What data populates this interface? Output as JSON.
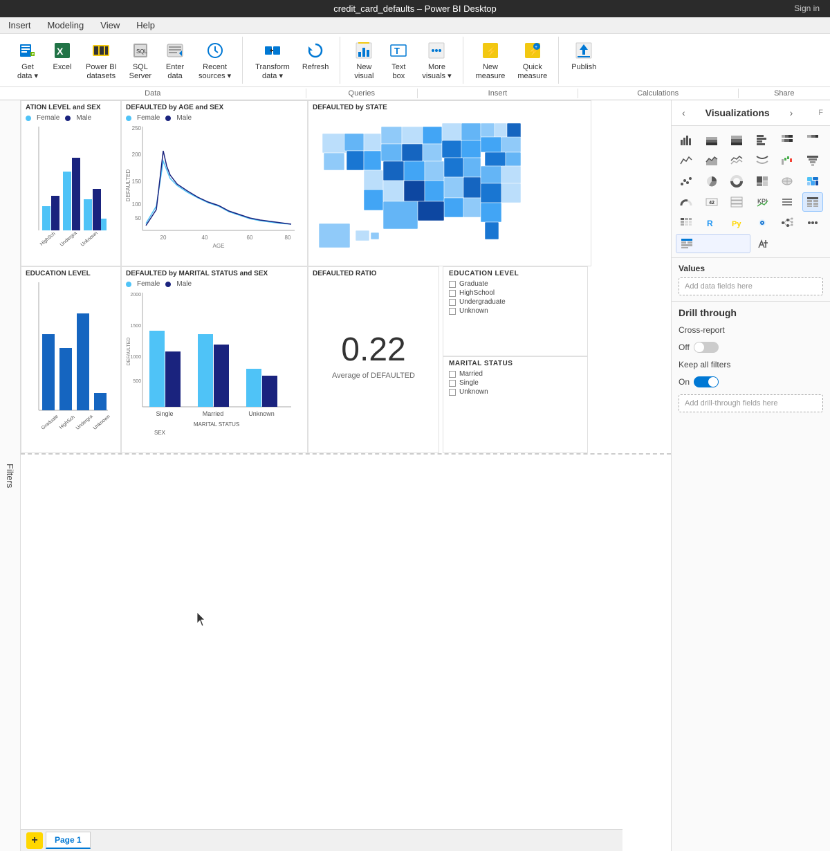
{
  "titlebar": {
    "title": "credit_card_defaults – Power BI Desktop",
    "signin": "Sign in"
  },
  "menu": {
    "items": [
      "Insert",
      "Modeling",
      "View",
      "Help"
    ]
  },
  "ribbon": {
    "groups": [
      {
        "label": "Data",
        "buttons": [
          {
            "id": "get-data",
            "icon": "🗄",
            "label": "Get\ndata ▾"
          },
          {
            "id": "excel",
            "icon": "📊",
            "label": "Excel"
          },
          {
            "id": "power-bi-datasets",
            "icon": "📁",
            "label": "Power BI\ndatasets"
          },
          {
            "id": "sql-server",
            "icon": "🔲",
            "label": "SQL\nServer"
          },
          {
            "id": "enter-data",
            "icon": "📋",
            "label": "Enter\ndata"
          },
          {
            "id": "recent-sources",
            "icon": "🕐",
            "label": "Recent\nsources ▾"
          }
        ]
      },
      {
        "label": "Queries",
        "buttons": [
          {
            "id": "transform-data",
            "icon": "⚙",
            "label": "Transform\ndata ▾"
          },
          {
            "id": "refresh",
            "icon": "🔄",
            "label": "Refresh"
          }
        ]
      },
      {
        "label": "Insert",
        "buttons": [
          {
            "id": "new-visual",
            "icon": "📈",
            "label": "New\nvisual"
          },
          {
            "id": "text-box",
            "icon": "T",
            "label": "Text\nbox"
          },
          {
            "id": "more-visuals",
            "icon": "📉",
            "label": "More\nvisuals ▾"
          }
        ]
      },
      {
        "label": "Calculations",
        "buttons": [
          {
            "id": "new-measure",
            "icon": "⚡",
            "label": "New\nmeasure"
          },
          {
            "id": "quick-measure",
            "icon": "⚡",
            "label": "Quick\nmeasure"
          }
        ]
      },
      {
        "label": "Share",
        "buttons": [
          {
            "id": "publish",
            "icon": "📤",
            "label": "Publish"
          }
        ]
      }
    ]
  },
  "canvas": {
    "charts": [
      {
        "id": "education",
        "title": "ATION LEVEL and SEX"
      },
      {
        "id": "age",
        "title": "DEFAULTED by AGE and SEX"
      },
      {
        "id": "state",
        "title": "DEFAULTED by STATE"
      },
      {
        "id": "edu-level",
        "title": "EDUCATION LEVEL"
      },
      {
        "id": "marital",
        "title": "DEFAULTED by MARITAL STATUS and SEX"
      },
      {
        "id": "ratio",
        "title": "DEFAULTED RATIO"
      },
      {
        "id": "edu-filter",
        "title": "EDUCATION LEVEL"
      },
      {
        "id": "marital-filter",
        "title": "MARITAL STATUS"
      }
    ],
    "ratio_value": "0.22",
    "ratio_label": "Average of DEFAULTED",
    "edu_items": [
      "Graduate",
      "HighSchool",
      "Undergraduate",
      "Unknown"
    ],
    "marital_items": [
      "Married",
      "Single",
      "Unknown"
    ],
    "age_legend": {
      "female_color": "#4fc3f7",
      "male_color": "#1a237e"
    },
    "sex_legend": {
      "female": "Female",
      "male": "Male"
    }
  },
  "visualizations": {
    "panel_title": "Visualizations",
    "tabs": [
      {
        "id": "fields",
        "icon": "≡",
        "label": "Fields"
      },
      {
        "id": "format",
        "icon": "🎨",
        "label": "Format"
      }
    ],
    "values_label": "Values",
    "values_placeholder": "Add data fields here",
    "drill_through_label": "Drill through",
    "cross_report_label": "Cross-report",
    "off_label": "Off",
    "keep_filters_label": "Keep all filters",
    "on_label": "On",
    "add_drill_placeholder": "Add drill-through fields here"
  },
  "filters": {
    "label": "Filters"
  },
  "pages": {
    "tabs": [
      "Page 1"
    ],
    "active": "Page 1",
    "add_label": "+"
  }
}
